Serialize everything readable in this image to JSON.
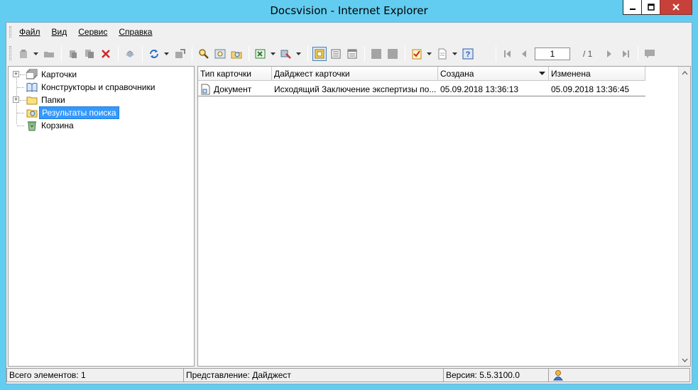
{
  "window": {
    "title": "Docsvision - Internet Explorer"
  },
  "menu": [
    {
      "first": "Ф",
      "rest": "айл"
    },
    {
      "first": "В",
      "rest": "ид"
    },
    {
      "first": "С",
      "rest": "ервис"
    },
    {
      "first": "С",
      "rest": "правка"
    }
  ],
  "toolbar": {
    "page_value": "1",
    "page_total": "/ 1"
  },
  "tree": {
    "items": [
      {
        "label": "Карточки",
        "expandable": true,
        "icon": "cards-icon"
      },
      {
        "label": "Конструкторы и справочники",
        "expandable": false,
        "icon": "book-icon"
      },
      {
        "label": "Папки",
        "expandable": true,
        "icon": "folder-icon"
      },
      {
        "label": "Результаты поиска",
        "expandable": false,
        "icon": "search-results-folder-icon",
        "selected": true
      },
      {
        "label": "Корзина",
        "expandable": false,
        "icon": "recycle-bin-icon"
      }
    ]
  },
  "table": {
    "columns": [
      "Тип карточки",
      "Дайджест карточки",
      "Создана",
      "Изменена"
    ],
    "sort_column": "Создана",
    "rows": [
      [
        "Документ",
        "Исходящий Заключение экспертизы по...",
        "05.09.2018 13:36:13",
        "05.09.2018 13:36:45"
      ]
    ]
  },
  "status": {
    "total": "Всего элементов: 1",
    "view": "Представление: Дайджест",
    "version": "Версия: 5.5.3100.0"
  },
  "colors": {
    "titlebar": "#62cdf0",
    "selection": "#3399ff",
    "close_button": "#c7403a"
  }
}
